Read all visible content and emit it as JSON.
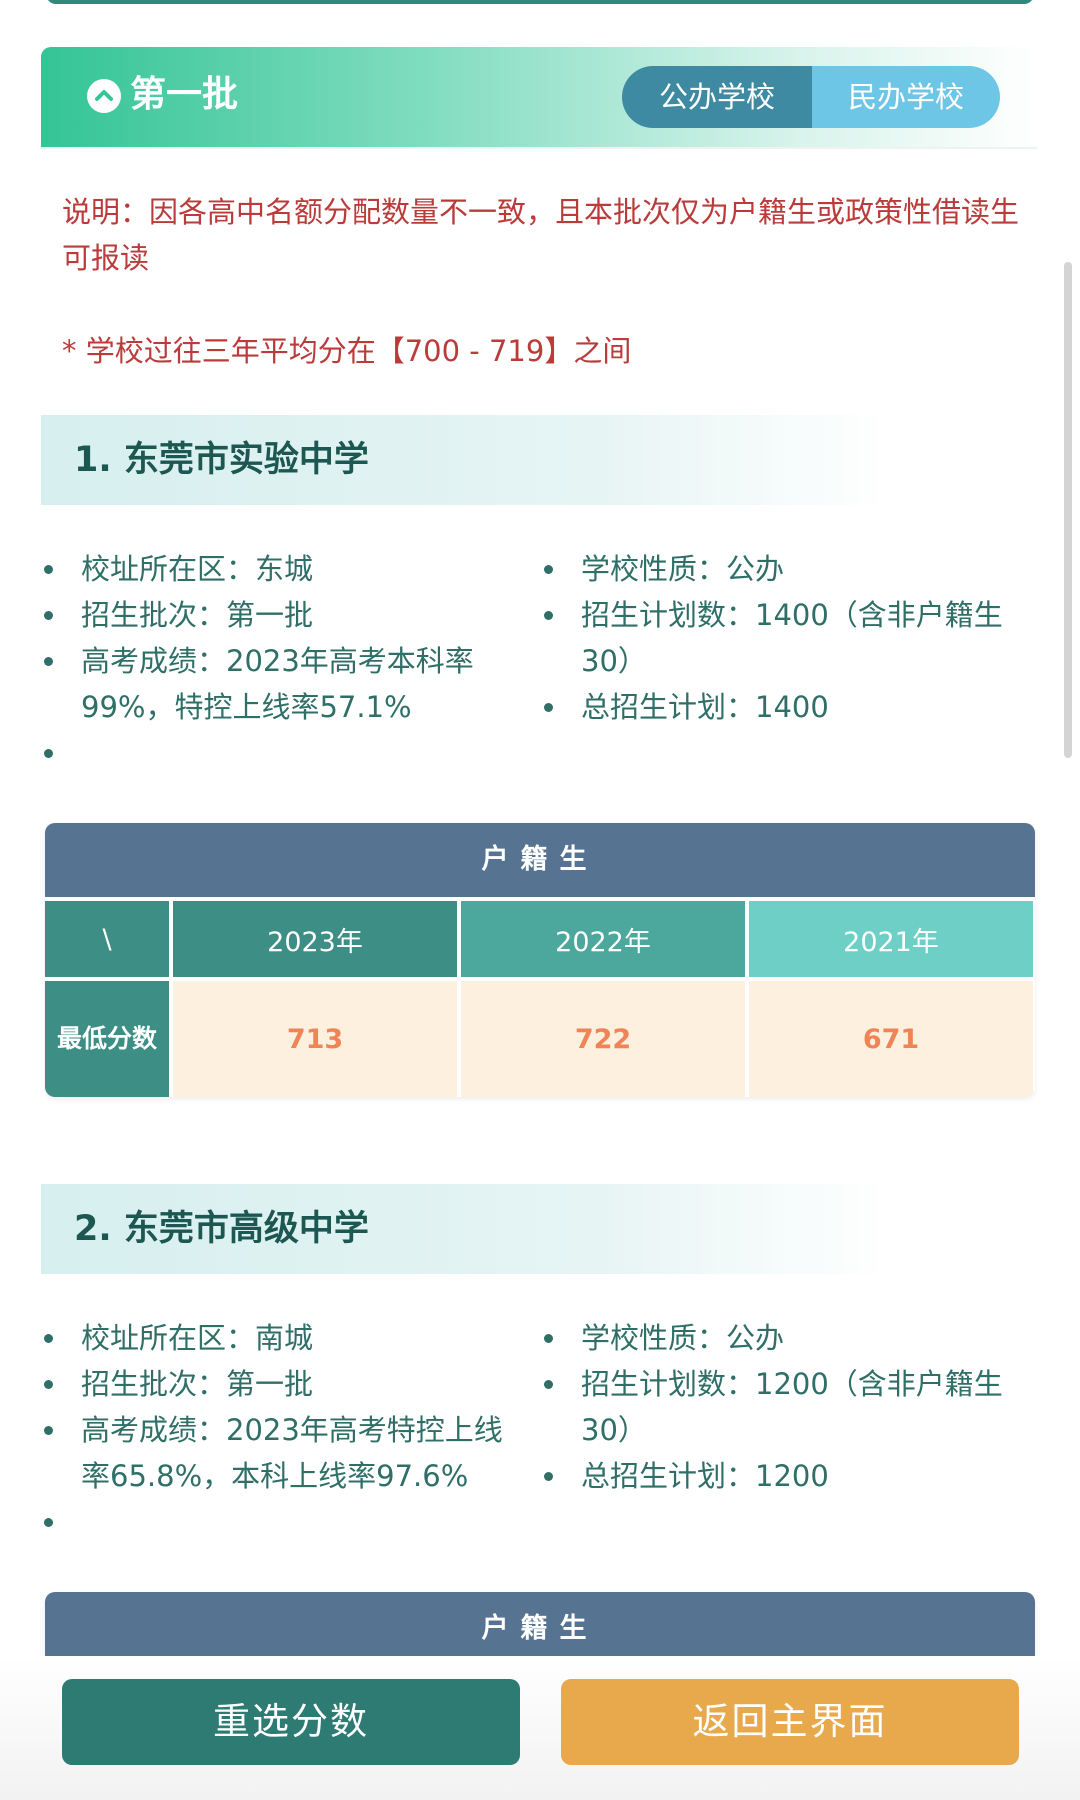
{
  "batch": {
    "title": "第一批",
    "tabs": [
      {
        "label": "公办学校",
        "selected": true
      },
      {
        "label": "民办学校",
        "selected": false
      }
    ]
  },
  "notes": {
    "description": "说明：因各高中名额分配数量不一致，且本批次仅为户籍生或政策性借读生可报读",
    "average_score": "* 学校过往三年平均分在【700 - 719】之间"
  },
  "schools": [
    {
      "title": "1. 东莞市实验中学",
      "left_items": [
        "校址所在区：东城",
        "招生批次：第一批",
        "高考成绩：2023年高考本科率99%，特控上线率57.1%"
      ],
      "right_items": [
        "学校性质：公办",
        "招生计划数：1400（含非户籍生30）",
        "总招生计划：1400"
      ],
      "table": {
        "title": "户籍生",
        "corner": "\\",
        "years": [
          "2023年",
          "2022年",
          "2021年"
        ],
        "row_label": "最低分数",
        "scores": [
          "713",
          "722",
          "671"
        ]
      }
    },
    {
      "title": "2. 东莞市高级中学",
      "left_items": [
        "校址所在区：南城",
        "招生批次：第一批",
        "高考成绩：2023年高考特控上线率65.8%，本科上线率97.6%"
      ],
      "right_items": [
        "学校性质：公办",
        "招生计划数：1200（含非户籍生30）",
        "总招生计划：1200"
      ],
      "table": {
        "title": "户籍生"
      }
    }
  ],
  "buttons": {
    "reselect": "重选分数",
    "home": "返回主界面"
  },
  "colors": {
    "accent_green": "#34c496",
    "dark_teal": "#2e7b73",
    "orange": "#e7a94c",
    "note_red": "#bb3b3b",
    "table_header": "#567491",
    "score": "#ef8456"
  }
}
